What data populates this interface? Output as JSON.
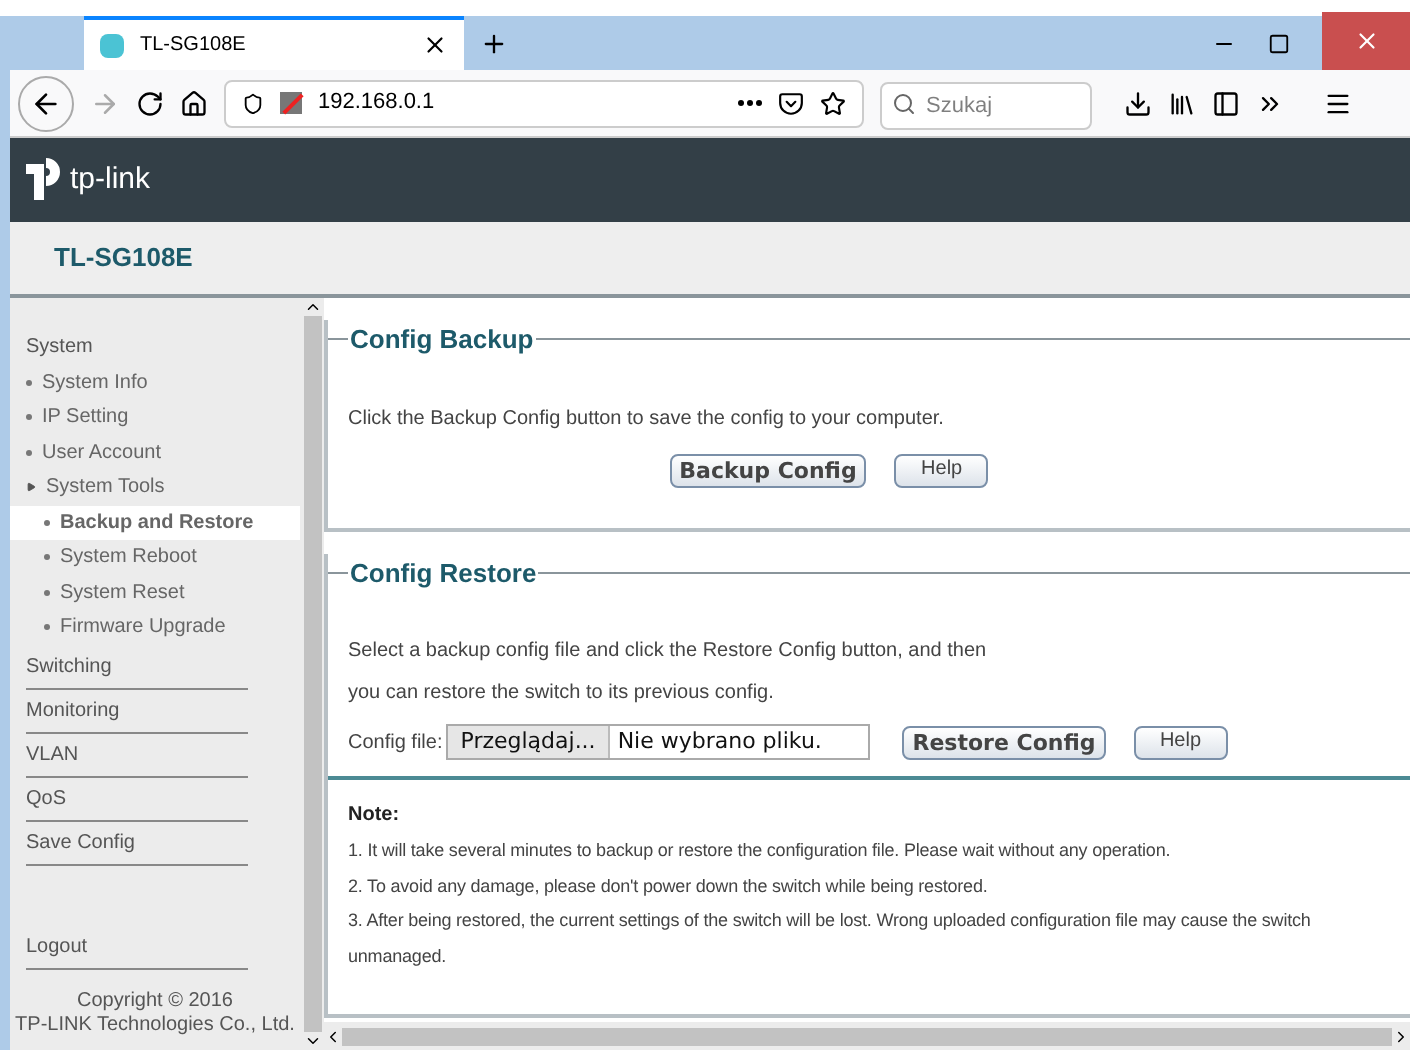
{
  "browser": {
    "tab_title": "TL-SG108E",
    "address": "192.168.0.1",
    "search": {
      "placeholder": "Szukaj"
    }
  },
  "header": {
    "brand": "tp-link",
    "model": "TL-SG108E"
  },
  "sidebar": {
    "items": [
      {
        "label": "System",
        "selected": false,
        "children": [
          {
            "label": "System Info",
            "selected": false
          },
          {
            "label": "IP Setting",
            "selected": false
          },
          {
            "label": "User Account",
            "selected": false
          },
          {
            "label": "System Tools",
            "selected": false,
            "expanded": true,
            "children": [
              {
                "label": "Backup and Restore",
                "selected": true
              },
              {
                "label": "System Reboot",
                "selected": false
              },
              {
                "label": "System Reset",
                "selected": false
              },
              {
                "label": "Firmware Upgrade",
                "selected": false
              }
            ]
          }
        ]
      },
      {
        "label": "Switching",
        "selected": false
      },
      {
        "label": "Monitoring",
        "selected": false
      },
      {
        "label": "VLAN",
        "selected": false
      },
      {
        "label": "QoS",
        "selected": false
      },
      {
        "label": "Save Config",
        "selected": false
      }
    ],
    "logout": "Logout",
    "copyright": [
      "Copyright © 2016",
      "TP-LINK Technologies Co., Ltd."
    ]
  },
  "backup": {
    "title": "Config Backup",
    "description": "Click the Backup Config button to save the config to your computer.",
    "buttons": [
      "Backup Config",
      "Help"
    ]
  },
  "restore": {
    "title": "Config Restore",
    "description": [
      "Select a backup config file and click the Restore Config button, and then",
      "you can restore the switch to its previous config."
    ],
    "file_label": "Config file:",
    "browse": "Przeglądaj...",
    "file_status": "Nie wybrano pliku.",
    "buttons": [
      "Restore Config",
      "Help"
    ]
  },
  "note": {
    "title": "Note:",
    "items": [
      "1. It will take several minutes to backup or restore the configuration file. Please wait without any operation.",
      "2. To avoid any damage, please don't power down the switch while being restored.",
      "3. After being restored, the current settings of the switch will be lost. Wrong uploaded configuration file may cause the switch",
      "unmanaged."
    ]
  }
}
